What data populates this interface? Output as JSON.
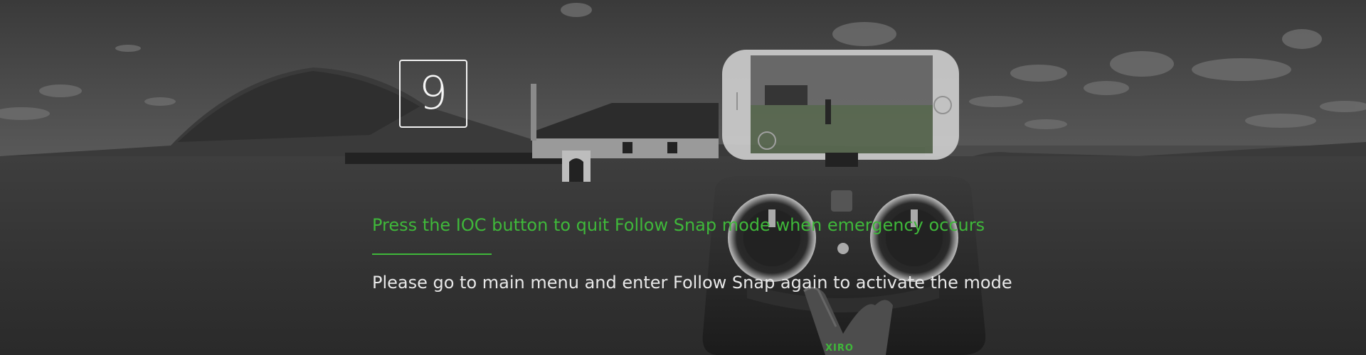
{
  "step": {
    "number": "9"
  },
  "headline": {
    "text": "Press the IOC button to quit Follow Snap mode when emergency occurs"
  },
  "subline": {
    "text": "Please go to main menu and enter Follow Snap again to activate the mode"
  },
  "controller": {
    "brand": "XIRO"
  },
  "colors": {
    "accent": "#3fb83a",
    "text": "#e8e8e8",
    "background": "#2b2b2b"
  }
}
